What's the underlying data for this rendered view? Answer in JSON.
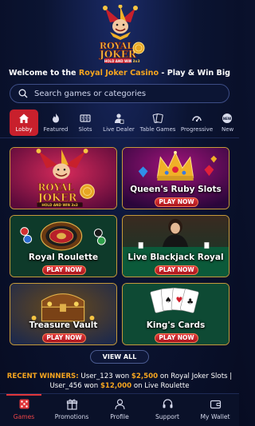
{
  "brand": {
    "logo_line1": "ROYAL",
    "logo_line2": "JOKER",
    "logo_tag": "HOLD AND WIN",
    "logo_sub": "3x3"
  },
  "welcome": {
    "prefix": "Welcome to the ",
    "highlight": "Royal Joker Casino",
    "suffix": " - Play & Win Big"
  },
  "search": {
    "placeholder": "Search games or categories"
  },
  "categories": [
    {
      "label": "Lobby",
      "icon": "home-icon",
      "active": true
    },
    {
      "label": "Featured",
      "icon": "flame-icon"
    },
    {
      "label": "Slots",
      "icon": "slot-reels-icon"
    },
    {
      "label": "Live Dealer",
      "icon": "dealer-icon"
    },
    {
      "label": "Table Games",
      "icon": "cards-icon"
    },
    {
      "label": "Progressive",
      "icon": "gauge-icon"
    },
    {
      "label": "New",
      "icon": "new-badge-icon"
    }
  ],
  "games": [
    {
      "title": "",
      "art_line1": "ROYAL",
      "art_line2": "JOKER",
      "art_tag": "HOLD AND WIN 3x3"
    },
    {
      "title": "Queen's Ruby Slots",
      "play": "PLAY NOW"
    },
    {
      "title": "Royal Roulette",
      "play": "PLAY NOW"
    },
    {
      "title": "Live Blackjack Royal",
      "play": "PLAY NOW"
    },
    {
      "title": "Treasure Vault",
      "play": "PLAY NOW"
    },
    {
      "title": "King's Cards",
      "play": "PLAY NOW"
    }
  ],
  "view_all": "VIEW ALL",
  "winners": {
    "label": "RECENT WINNERS:",
    "entries": [
      {
        "user": "User_123",
        "won": " won ",
        "amount": "$2,500",
        "on": " on Royal Joker Slots"
      },
      {
        "user": "User_456",
        "won": " won ",
        "amount": "$12,000",
        "on": " on Live Roulette"
      }
    ],
    "separator": "|"
  },
  "nav": [
    {
      "label": "Games",
      "icon": "dice-icon",
      "active": true
    },
    {
      "label": "Promotions",
      "icon": "gift-icon"
    },
    {
      "label": "Profile",
      "icon": "user-icon"
    },
    {
      "label": "Support",
      "icon": "headset-icon"
    },
    {
      "label": "My Wallet",
      "icon": "wallet-icon"
    }
  ],
  "colors": {
    "accent_gold": "#f6a51f",
    "accent_red": "#c8202c",
    "background": "#0b1432",
    "card_border": "#c59a3a"
  }
}
